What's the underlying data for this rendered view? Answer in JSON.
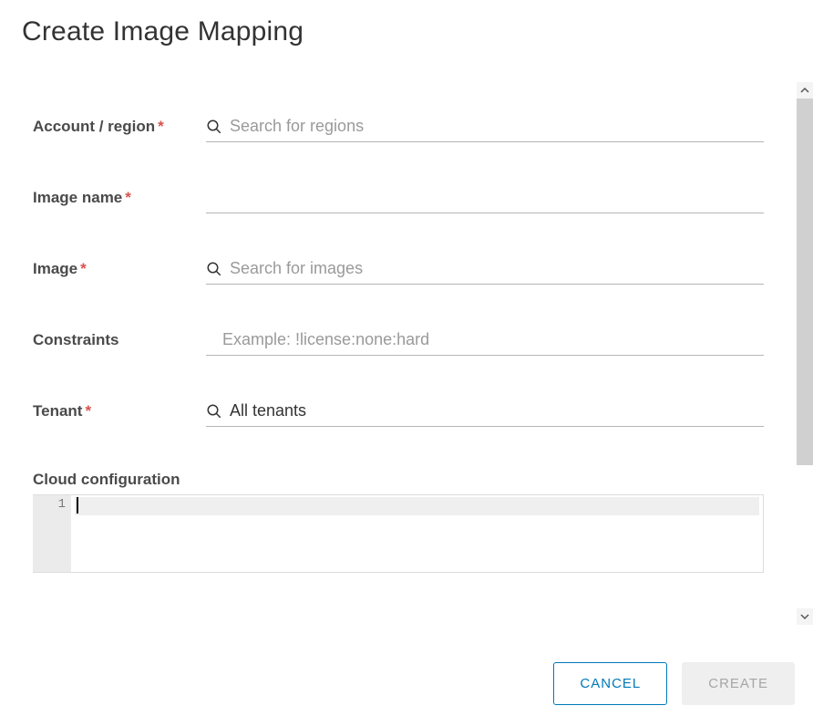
{
  "title": "Create Image Mapping",
  "fields": {
    "account_region": {
      "label": "Account / region",
      "required": true,
      "placeholder": "Search for regions",
      "value": ""
    },
    "image_name": {
      "label": "Image name",
      "required": true,
      "placeholder": "",
      "value": ""
    },
    "image": {
      "label": "Image",
      "required": true,
      "placeholder": "Search for images",
      "value": ""
    },
    "constraints": {
      "label": "Constraints",
      "required": false,
      "placeholder": "Example: !license:none:hard",
      "value": ""
    },
    "tenant": {
      "label": "Tenant",
      "required": true,
      "placeholder": "",
      "value": "All tenants"
    }
  },
  "editor": {
    "label": "Cloud configuration",
    "line_number": "1",
    "content": ""
  },
  "buttons": {
    "cancel": "CANCEL",
    "create": "CREATE"
  },
  "required_marker": "*"
}
